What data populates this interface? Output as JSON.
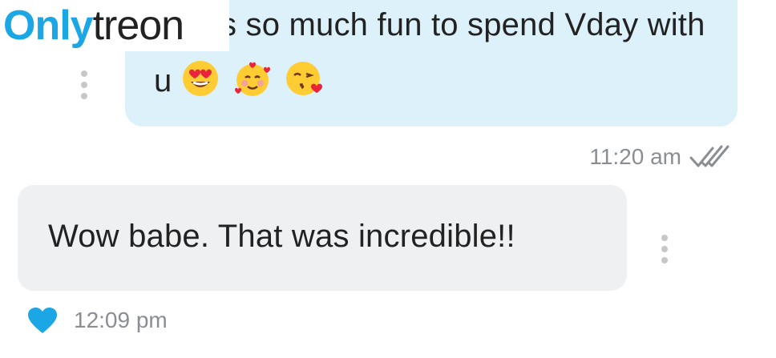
{
  "watermark": {
    "part_a": "Only",
    "part_b": "treon"
  },
  "messages": {
    "outgoing": {
      "text": "y was so much fun to spend Vday with u",
      "emojis": [
        "heart-eyes-emoji",
        "party-face-hearts-emoji",
        "kiss-heart-emoji"
      ],
      "time": "11:20 am",
      "status_icon": "double-check-icon",
      "bubble_color": "#ddf1fb"
    },
    "incoming": {
      "text": "Wow babe. That was incredible!!",
      "time": "12:09 pm",
      "reaction_icon": "heart-icon",
      "reaction_color": "#1ba6e5",
      "bubble_color": "#eef0f2"
    }
  },
  "colors": {
    "accent": "#1ba6e5",
    "meta_text": "#8a8e93"
  }
}
